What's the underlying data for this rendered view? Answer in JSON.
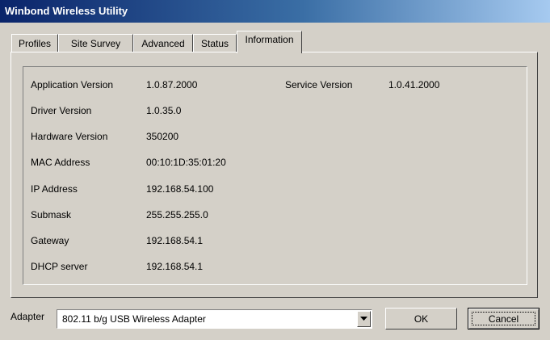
{
  "window": {
    "title": "Winbond Wireless Utility"
  },
  "tabs": [
    {
      "label": "Profiles"
    },
    {
      "label": "Site Survey"
    },
    {
      "label": "Advanced"
    },
    {
      "label": "Status"
    },
    {
      "label": "Information",
      "active": true
    }
  ],
  "info": {
    "rows": [
      {
        "label": "Application Version",
        "value": "1.0.87.2000"
      },
      {
        "label": "Driver Version",
        "value": "1.0.35.0"
      },
      {
        "label": "Hardware Version",
        "value": "350200"
      },
      {
        "label": "MAC Address",
        "value": "00:10:1D:35:01:20"
      },
      {
        "label": "IP Address",
        "value": "192.168.54.100"
      },
      {
        "label": "Submask",
        "value": "255.255.255.0"
      },
      {
        "label": "Gateway",
        "value": "192.168.54.1"
      },
      {
        "label": "DHCP server",
        "value": "192.168.54.1"
      }
    ],
    "service_label": "Service Version",
    "service_value": "1.0.41.2000"
  },
  "footer": {
    "adapter_label": "Adapter",
    "adapter_selected": "802.11 b/g USB Wireless Adapter",
    "ok_label": "OK",
    "cancel_label": "Cancel"
  },
  "colors": {
    "face": "#d4d0c8",
    "titlebar_start": "#0a246a",
    "titlebar_end": "#a6caf0",
    "title_text": "#ffffff"
  }
}
